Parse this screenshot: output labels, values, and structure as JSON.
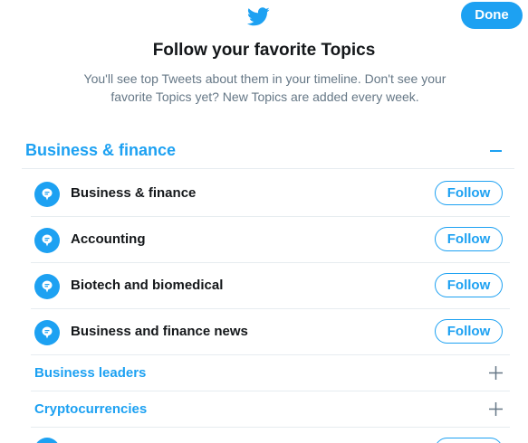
{
  "header": {
    "logo_icon": "twitter-bird-icon",
    "done_label": "Done"
  },
  "intro": {
    "title": "Follow your favorite Topics",
    "subtitle": "You'll see top Tweets about them in your timeline. Don't see your favorite Topics yet? New Topics are added every week."
  },
  "section": {
    "title": "Business & finance",
    "toggle_icon": "collapse-minus-icon",
    "topics": [
      {
        "label": "Business & finance",
        "follow_label": "Follow",
        "icon": "topic-bubble-icon"
      },
      {
        "label": "Accounting",
        "follow_label": "Follow",
        "icon": "topic-bubble-icon"
      },
      {
        "label": "Biotech and biomedical",
        "follow_label": "Follow",
        "icon": "topic-bubble-icon"
      },
      {
        "label": "Business and finance news",
        "follow_label": "Follow",
        "icon": "topic-bubble-icon"
      }
    ],
    "subcategories": [
      {
        "label": "Business leaders",
        "toggle_icon": "expand-plus-icon"
      },
      {
        "label": "Cryptocurrencies",
        "toggle_icon": "expand-plus-icon"
      }
    ]
  },
  "colors": {
    "accent": "#1da1f2",
    "text_primary": "#14171a",
    "text_secondary": "#657786",
    "divider": "#e6ecf0"
  }
}
